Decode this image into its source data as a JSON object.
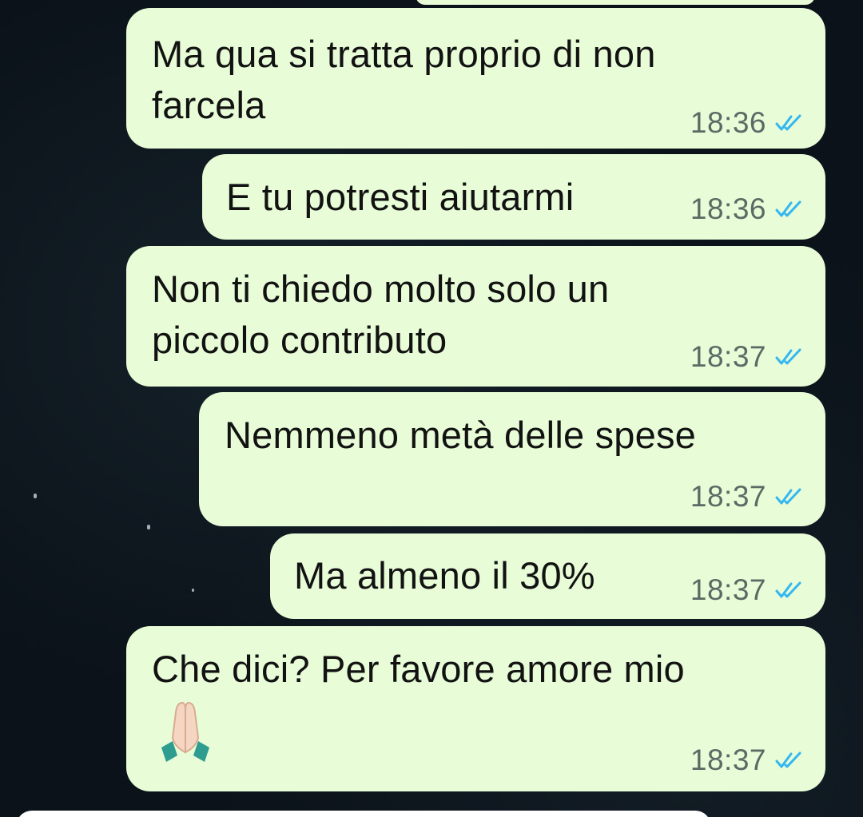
{
  "messages": [
    {
      "text": "Ma qua si tratta proprio di non\nfarcela",
      "time": "18:36",
      "status_icon": "read-double-check-icon"
    },
    {
      "text": "E tu potresti aiutarmi",
      "time": "18:36",
      "status_icon": "read-double-check-icon"
    },
    {
      "text": "Non ti chiedo molto solo un\npiccolo contributo",
      "time": "18:37",
      "status_icon": "read-double-check-icon"
    },
    {
      "text": "Nemmeno metà delle spese",
      "time": "18:37",
      "status_icon": "read-double-check-icon"
    },
    {
      "text": "Ma almeno il 30%",
      "time": "18:37",
      "status_icon": "read-double-check-icon"
    },
    {
      "text": "Che dici? Per favore amore mio",
      "time": "18:37",
      "status_icon": "read-double-check-icon",
      "emoji": "folded-hands-icon"
    }
  ],
  "colors": {
    "bubble": "#e7fcd7",
    "background": "#0b1219",
    "time": "#5b6a64",
    "read_ticks": "#34b7f1"
  }
}
